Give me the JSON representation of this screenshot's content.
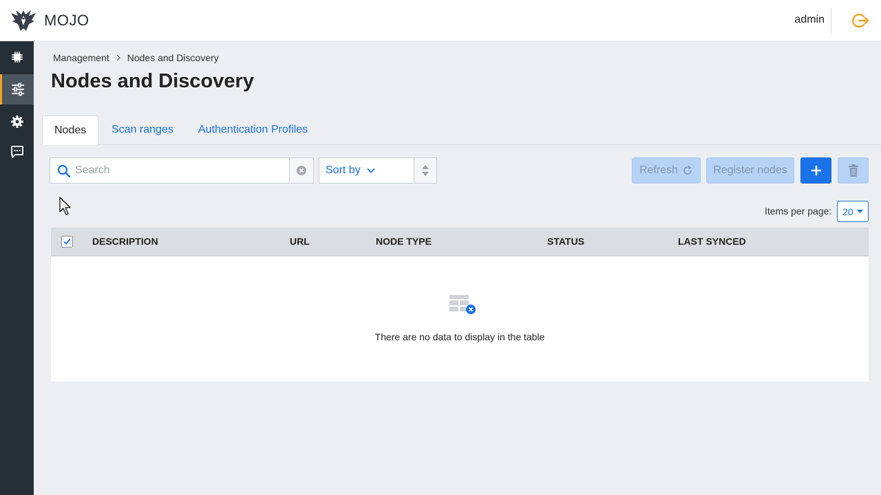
{
  "header": {
    "brand": "MOJO",
    "user": "admin",
    "logo_icon": "eagle-logo-icon",
    "logout_icon": "logout-icon",
    "accent_color": "#f0a321"
  },
  "sidebar": {
    "items": [
      {
        "icon": "chip-icon",
        "active": false
      },
      {
        "icon": "sliders-icon",
        "active": true
      },
      {
        "icon": "gear-icon",
        "active": false
      },
      {
        "icon": "chat-icon",
        "active": false
      }
    ]
  },
  "breadcrumb": [
    "Management",
    "Nodes and Discovery"
  ],
  "page_title": "Nodes and Discovery",
  "tabs": [
    {
      "label": "Nodes",
      "active": true
    },
    {
      "label": "Scan ranges",
      "active": false
    },
    {
      "label": "Authentication Profiles",
      "active": false
    }
  ],
  "toolbar": {
    "search_placeholder": "Search",
    "search_value": "",
    "sort_label": "Sort by",
    "refresh_label": "Refresh",
    "register_label": "Register nodes",
    "add_label": "+"
  },
  "pagination": {
    "items_per_page_label": "Items per page:",
    "items_per_page_value": "20"
  },
  "table": {
    "columns": [
      "DESCRIPTION",
      "URL",
      "NODE TYPE",
      "STATUS",
      "LAST SYNCED"
    ],
    "rows": [],
    "empty_message": "There are no data to display in the table"
  },
  "colors": {
    "primary": "#1a73e8",
    "sidebar_bg": "#262f36",
    "disabled_btn": "#b6d3f6"
  }
}
